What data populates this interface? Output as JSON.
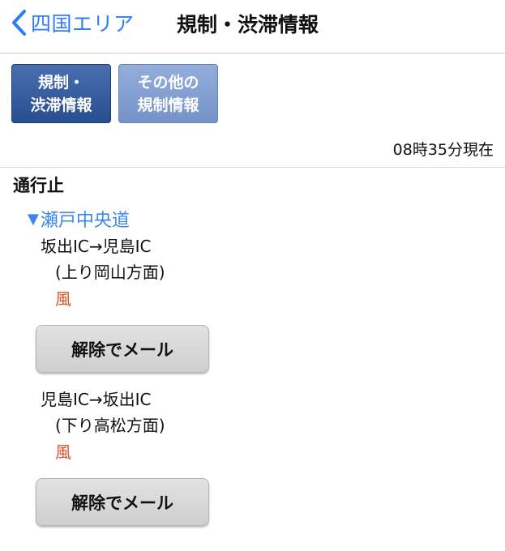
{
  "header": {
    "back_label": "四国エリア",
    "title": "規制・渋滞情報"
  },
  "tabs": [
    {
      "label": "規制・\n渋滞情報",
      "active": true
    },
    {
      "label": "その他の\n規制情報",
      "active": false
    }
  ],
  "timestamp": "08時35分現在",
  "section": {
    "heading": "通行止",
    "road_name": "瀬戸中央道",
    "items": [
      {
        "route": "坂出IC→児島IC",
        "direction": "(上り岡山方面)",
        "cause": "風",
        "button_label": "解除でメール"
      },
      {
        "route": "児島IC→坂出IC",
        "direction": "(下り高松方面)",
        "cause": "風",
        "button_label": "解除でメール"
      }
    ]
  },
  "colors": {
    "accent": "#2f7cf6",
    "link": "#3b87e8",
    "cause": "#d9532b",
    "tab_active": "#294e90",
    "tab_inactive": "#7593c8"
  }
}
